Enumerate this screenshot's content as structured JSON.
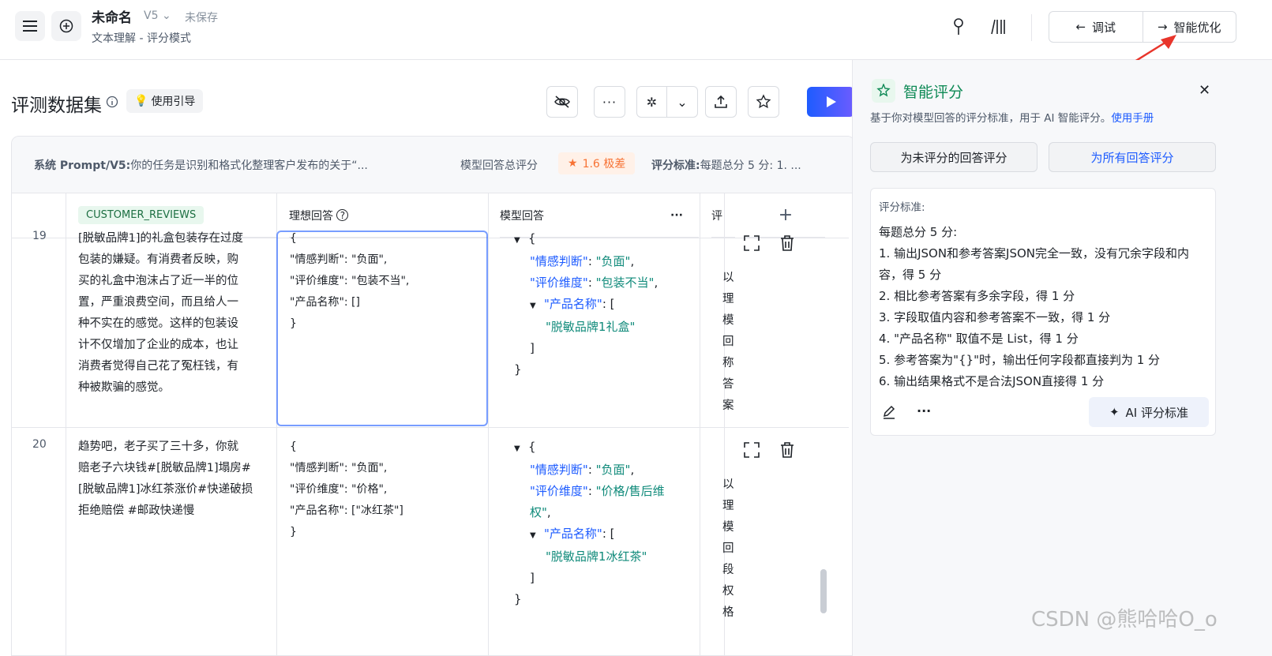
{
  "header": {
    "title": "未命名",
    "version": "V5",
    "save_status": "未保存",
    "subtitle": "文本理解 - 评分模式",
    "debug_label": "调试",
    "optimize_label": "智能优化"
  },
  "dataset": {
    "title": "评测数据集",
    "guide_label": "使用引导"
  },
  "prompt_bar": {
    "system_label": "系统 Prompt/V5:",
    "system_text": "你的任务是识别和格式化整理客户发布的关于“...",
    "total_label": "模型回答总评分",
    "score": "1.6 极差",
    "criteria_label": "评分标准:",
    "criteria_text": "每题总分 5 分:  1. ..."
  },
  "columns": {
    "input": "CUSTOMER_REVIEWS",
    "ideal": "理想回答",
    "model": "模型回答",
    "score_col": "评"
  },
  "rows": [
    {
      "num": "19",
      "review": [
        "[脱敏品牌1]的礼盒包装存在过度",
        "包装的嫌疑。有消费者反映，购",
        "买的礼盒中泡沫占了近一半的位",
        "置，严重浪费空间，而且给人一",
        "种不实在的感觉。这样的包装设",
        "计不仅增加了企业的成本，也让",
        "消费者觉得自己花了冤枉钱，有",
        "种被欺骗的感觉。"
      ],
      "ideal": [
        "{",
        "\"情感判断\": \"负面\",",
        "\"评价维度\": \"包装不当\",",
        "\"产品名称\": []",
        "}"
      ],
      "model": {
        "k1": "\"情感判断\"",
        "v1": "\"负面\"",
        "k2": "\"评价维度\"",
        "v2": "\"包装不当\"",
        "k3": "\"产品名称\"",
        "v3": "\"脱敏品牌1礼盒\""
      },
      "reason": [
        "以",
        "理",
        "模",
        "回",
        "称",
        "答",
        "案"
      ]
    },
    {
      "num": "20",
      "review": [
        "趋势吧，老子买了三十多，你就",
        "赔老子六块钱#[脱敏品牌1]塌房#",
        "[脱敏品牌1]冰红茶涨价#快递破损",
        "拒绝赔偿 #邮政快递慢"
      ],
      "ideal": [
        "{",
        "\"情感判断\": \"负面\",",
        "\"评价维度\": \"价格\",",
        "\"产品名称\": [\"冰红茶\"]",
        "}"
      ],
      "model": {
        "k1": "\"情感判断\"",
        "v1": "\"负面\"",
        "k2": "\"评价维度\"",
        "v2a": "\"价格/售后维",
        "v2b": "权\"",
        "k3": "\"产品名称\"",
        "v3": "\"脱敏品牌1冰红茶\""
      },
      "reason": [
        "以",
        "理",
        "模",
        "回",
        "段",
        "权",
        "格"
      ]
    }
  ],
  "panel": {
    "title": "智能评分",
    "desc": "基于你对模型回答的评分标准，用于 AI 智能评分。",
    "manual_link": "使用手册",
    "btn_unscored": "为未评分的回答评分",
    "btn_all": "为所有回答评分",
    "criteria_label": "评分标准:",
    "criteria_lines": [
      "每题总分 5 分:",
      "1. 输出JSON和参考答案JSON完全一致，没有冗余字段和内",
      "容，得 5 分",
      "2. 相比参考答案有多余字段，得 1 分",
      "3. 字段取值内容和参考答案不一致，得 1 分",
      "4. \"产品名称\" 取值不是 List，得 1 分",
      "5. 参考答案为\"{}\"时，输出任何字段都直接判为 1 分",
      "6. 输出结果格式不是合法JSON直接得 1 分"
    ],
    "ai_btn": "AI 评分标准"
  },
  "watermark": "CSDN @熊哈哈O_o",
  "colors": {
    "accent": "#1e5cff",
    "green": "#0f8a56",
    "warn": "#f77234"
  }
}
